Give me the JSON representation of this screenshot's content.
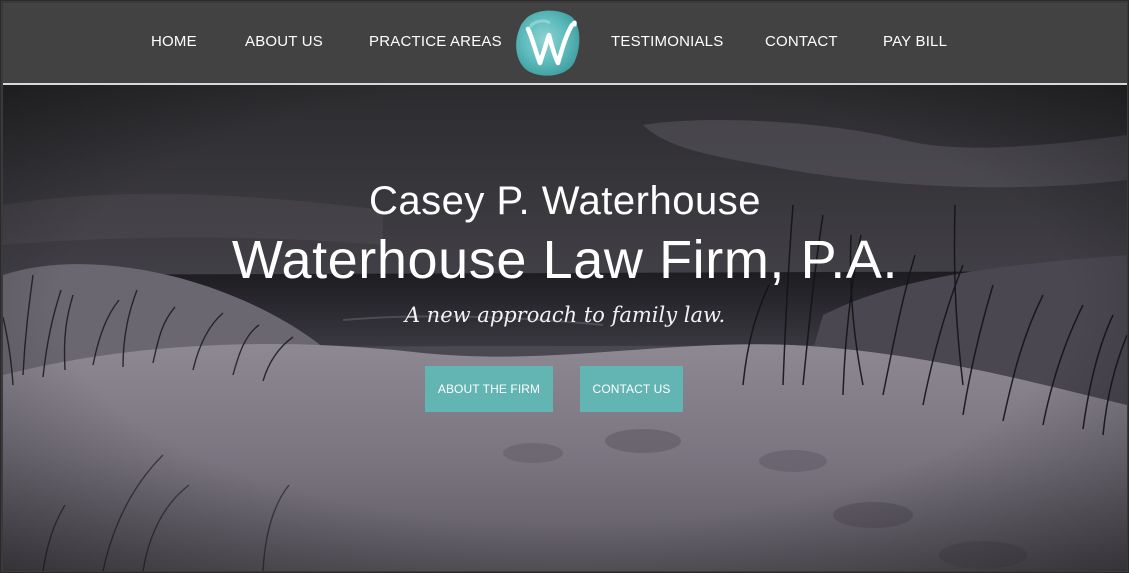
{
  "nav": {
    "items": [
      {
        "label": "HOME"
      },
      {
        "label": "ABOUT US"
      },
      {
        "label": "PRACTICE AREAS"
      },
      {
        "label": "TESTIMONIALS"
      },
      {
        "label": "CONTACT"
      },
      {
        "label": "PAY BILL"
      }
    ],
    "logo": {
      "letter": "W",
      "icon": "w-watercolor-logo-icon",
      "color": "#5fbdbd"
    }
  },
  "hero": {
    "name": "Casey P. Waterhouse",
    "firm": "Waterhouse Law Firm, P.A.",
    "tagline": "A new approach to family law.",
    "buttons": {
      "about_label": "ABOUT THE FIRM",
      "contact_label": "CONTACT US"
    }
  },
  "colors": {
    "header_bg": "#424242",
    "accent": "#62b5b3",
    "text": "#ffffff"
  }
}
